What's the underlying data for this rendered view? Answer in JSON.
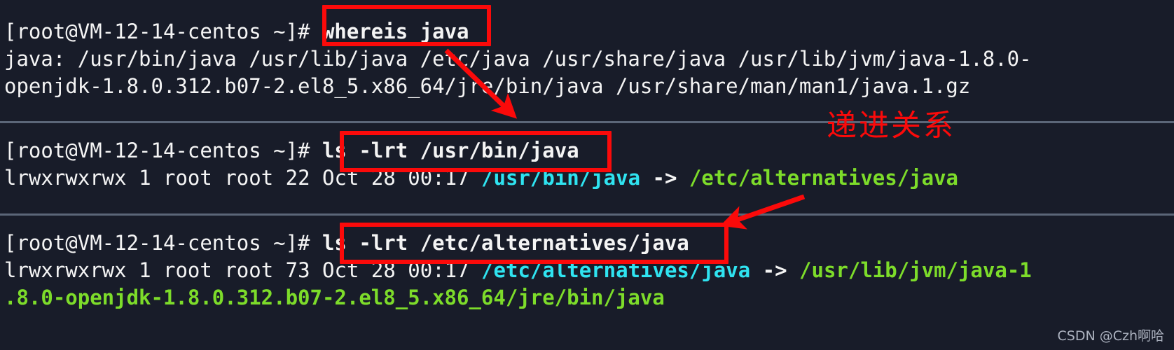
{
  "terminal": {
    "background_color": "#181c29",
    "foreground_color": "#f4f4f4",
    "symlink_source_color": "#2fe3f0",
    "symlink_target_color": "#7ddc2a",
    "prompt": "[root@VM-12-14-centos ~]#",
    "blocks": [
      {
        "id": "block-whereis",
        "command": "whereis java",
        "output_lines": [
          "java: /usr/bin/java /usr/lib/java /etc/java /usr/share/java /usr/lib/jvm/java-1.8.0-",
          "openjdk-1.8.0.312.b07-2.el8_5.x86_64/jre/bin/java /usr/share/man/man1/java.1.gz"
        ]
      },
      {
        "id": "block-ls-usr-bin",
        "command": "ls -lrt /usr/bin/java",
        "listing": {
          "permissions": "lrwxrwxrwx",
          "links": "1",
          "owner": "root",
          "group": "root",
          "size": "22",
          "month": "Oct",
          "day": "28",
          "time": "00:17",
          "name": "/usr/bin/java",
          "arrow": "->",
          "target": "/etc/alternatives/java"
        }
      },
      {
        "id": "block-ls-etc-alternatives",
        "command": "ls -lrt /etc/alternatives/java",
        "listing": {
          "permissions": "lrwxrwxrwx",
          "links": "1",
          "owner": "root",
          "group": "root",
          "size": "73",
          "month": "Oct",
          "day": "28",
          "time": "00:17",
          "name": "/etc/alternatives/java",
          "arrow": "->",
          "target_part1": "/usr/lib/jvm/java-1",
          "target_part2": ".8.0-openjdk-1.8.0.312.b07-2.el8_5.x86_64/jre/bin/java"
        }
      }
    ]
  },
  "annotations": {
    "highlight_color": "#fb0a0a",
    "note_text": "递进关系",
    "boxes": [
      {
        "id": "highlight-box-whereis",
        "label": "whereis java"
      },
      {
        "id": "highlight-box-ls-usr-bin",
        "label": "ls -lrt /usr/bin/java"
      },
      {
        "id": "highlight-box-ls-etc-alternatives",
        "label": "ls -lrt /etc/alternatives/java"
      }
    ],
    "arrows": [
      {
        "id": "arrow-1",
        "from": "whereis-output-jvm-path",
        "to": "ls-usr-bin-command"
      },
      {
        "id": "arrow-2",
        "from": "ls-usr-bin-symlink-target",
        "to": "ls-etc-alternatives-command"
      }
    ]
  },
  "watermark": {
    "text": "CSDN @Czh啊哈"
  }
}
